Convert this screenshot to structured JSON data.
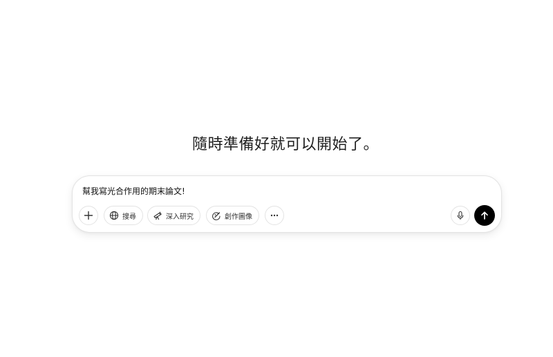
{
  "main": {
    "headline": "隨時準備好就可以開始了。"
  },
  "composer": {
    "input_value": "幫我寫光合作用的期末論文!",
    "tools": [
      {
        "label": "搜尋",
        "icon": "globe-icon"
      },
      {
        "label": "深入研究",
        "icon": "telescope-icon"
      },
      {
        "label": "創作圖像",
        "icon": "image-create-icon"
      }
    ],
    "buttons": {
      "add": "plus-icon",
      "more": "ellipsis-icon",
      "voice": "microphone-icon",
      "send": "arrow-up-icon"
    },
    "colors": {
      "send_button_bg": "#000000",
      "border": "#e3e3e3"
    }
  }
}
